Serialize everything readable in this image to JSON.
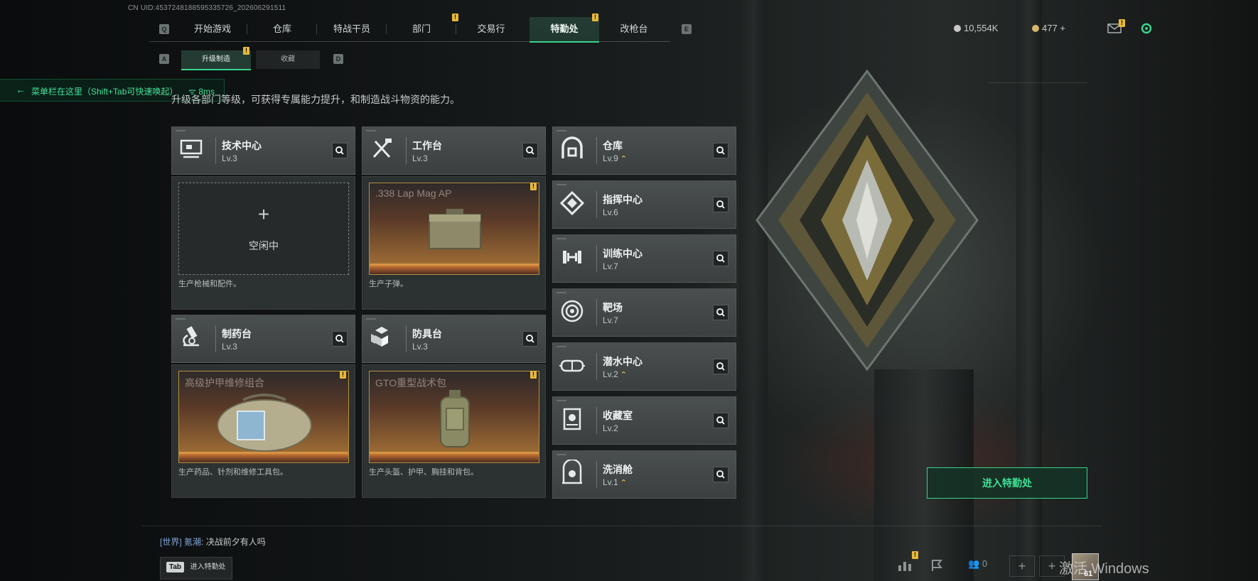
{
  "uid": "CN UID:4537248188595335726_202606291511",
  "nav": {
    "left_key": "Q",
    "right_key": "E",
    "tabs": [
      {
        "label": "开始游戏",
        "badge": false
      },
      {
        "label": "仓库",
        "badge": false
      },
      {
        "label": "特战干员",
        "badge": false
      },
      {
        "label": "部门",
        "badge": true
      },
      {
        "label": "交易行",
        "badge": false
      },
      {
        "label": "特勤处",
        "badge": true,
        "active": true
      },
      {
        "label": "改枪台",
        "badge": false
      }
    ],
    "badge_mark": "!"
  },
  "currency": {
    "coins": "10,554K",
    "points": "477",
    "plus": "+"
  },
  "subnav": {
    "left_key": "A",
    "right_key": "D",
    "tabs": [
      {
        "label": "升级制造",
        "active": true
      },
      {
        "label": "收藏",
        "active": false
      }
    ]
  },
  "hint": {
    "text": "菜单栏在这里（Shift+Tab可快速唤起）",
    "ping": "8ms"
  },
  "description": "升级各部门等级，可获得专属能力提升，和制造战斗物资的能力。",
  "production": [
    {
      "name": "技术中心",
      "level": "Lv.3",
      "icon": "computer-icon",
      "slot": {
        "state": "empty",
        "plus": "+",
        "status": "空闲中"
      },
      "caption": "生产枪械和配件。"
    },
    {
      "name": "工作台",
      "level": "Lv.3",
      "icon": "tools-icon",
      "slot": {
        "state": "item",
        "item": ".338 Lap Mag AP"
      },
      "caption": "生产子弹。"
    },
    {
      "name": "制药台",
      "level": "Lv.3",
      "icon": "microscope-icon",
      "slot": {
        "state": "item",
        "item": "高级护甲维修组合"
      },
      "caption": "生产药品、针剂和维修工具包。"
    },
    {
      "name": "防具台",
      "level": "Lv.3",
      "icon": "armor-blocks-icon",
      "slot": {
        "state": "item",
        "item": "GTO重型战术包"
      },
      "caption": "生产头盔、护甲、胸挂和背包。"
    }
  ],
  "departments": [
    {
      "name": "仓库",
      "level": "Lv.9",
      "upgradable": true,
      "icon": "warehouse-icon"
    },
    {
      "name": "指挥中心",
      "level": "Lv.6",
      "upgradable": false,
      "icon": "command-chip-icon"
    },
    {
      "name": "训练中心",
      "level": "Lv.7",
      "upgradable": false,
      "icon": "dumbbell-icon"
    },
    {
      "name": "靶场",
      "level": "Lv.7",
      "upgradable": false,
      "icon": "target-icon"
    },
    {
      "name": "潜水中心",
      "level": "Lv.2",
      "upgradable": true,
      "icon": "diving-mask-icon"
    },
    {
      "name": "收藏室",
      "level": "Lv.2",
      "upgradable": false,
      "icon": "collection-icon"
    },
    {
      "name": "洗消舱",
      "level": "Lv.1",
      "upgradable": true,
      "icon": "decon-icon"
    }
  ],
  "upgrade_mark": "⌃",
  "enter_button": "进入特勤处",
  "chat": {
    "channel": "[世界]",
    "user": "氪潮",
    "message": ": 决战前夕有人吗"
  },
  "tab_hint": {
    "key": "Tab",
    "label": "进入特勤处"
  },
  "bottom_right": {
    "friends": "0",
    "avatar_level": "61"
  },
  "watermark": "激活 Windows",
  "colors": {
    "accent": "#39d48a",
    "badge": "#e7b93a",
    "card": "#454a4a"
  }
}
